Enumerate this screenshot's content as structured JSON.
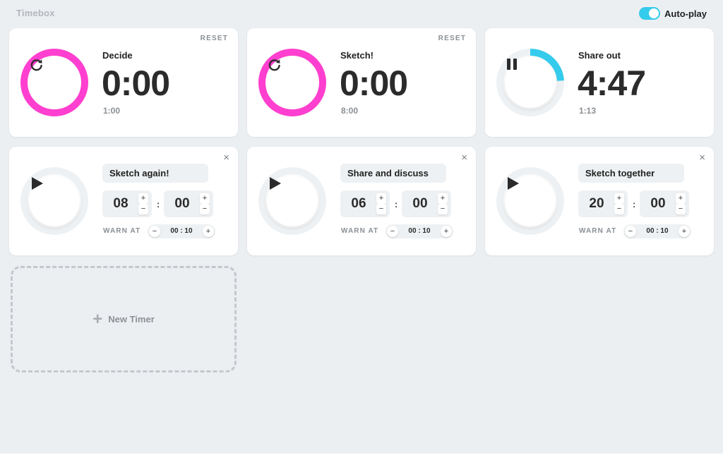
{
  "app": {
    "title": "Timebox"
  },
  "autoplay": {
    "label": "Auto-play",
    "enabled": true
  },
  "colors": {
    "done_ring": "#ff3fcf",
    "progress_ring": "#35cbec",
    "track": "#eef1f3",
    "accent": "#35cbec"
  },
  "running_timers": [
    {
      "name": "Decide",
      "remaining": "0:00",
      "sub": "1:00",
      "reset_label": "RESET",
      "state": "done",
      "progress": 1.0,
      "icon": "restart-icon"
    },
    {
      "name": "Sketch!",
      "remaining": "0:00",
      "sub": "8:00",
      "reset_label": "RESET",
      "state": "done",
      "progress": 1.0,
      "icon": "restart-icon"
    },
    {
      "name": "Share out",
      "remaining": "4:47",
      "sub": "1:13",
      "reset_label": "",
      "state": "running",
      "progress": 0.24,
      "icon": "pause-icon"
    }
  ],
  "queued_timers": [
    {
      "name": "Sketch again!",
      "minutes": "08",
      "seconds": "00",
      "separator": ":",
      "warn_label": "WARN AT",
      "warn_value": "00 : 10",
      "plus": "+",
      "minus": "−",
      "close": "×",
      "icon": "play-icon"
    },
    {
      "name": "Share and discuss",
      "minutes": "06",
      "seconds": "00",
      "separator": ":",
      "warn_label": "WARN AT",
      "warn_value": "00 : 10",
      "plus": "+",
      "minus": "−",
      "close": "×",
      "icon": "play-icon"
    },
    {
      "name": "Sketch together",
      "minutes": "20",
      "seconds": "00",
      "separator": ":",
      "warn_label": "WARN AT",
      "warn_value": "00 : 10",
      "plus": "+",
      "minus": "−",
      "close": "×",
      "icon": "play-icon"
    }
  ],
  "new_timer": {
    "label": "New Timer",
    "plus": "+"
  }
}
